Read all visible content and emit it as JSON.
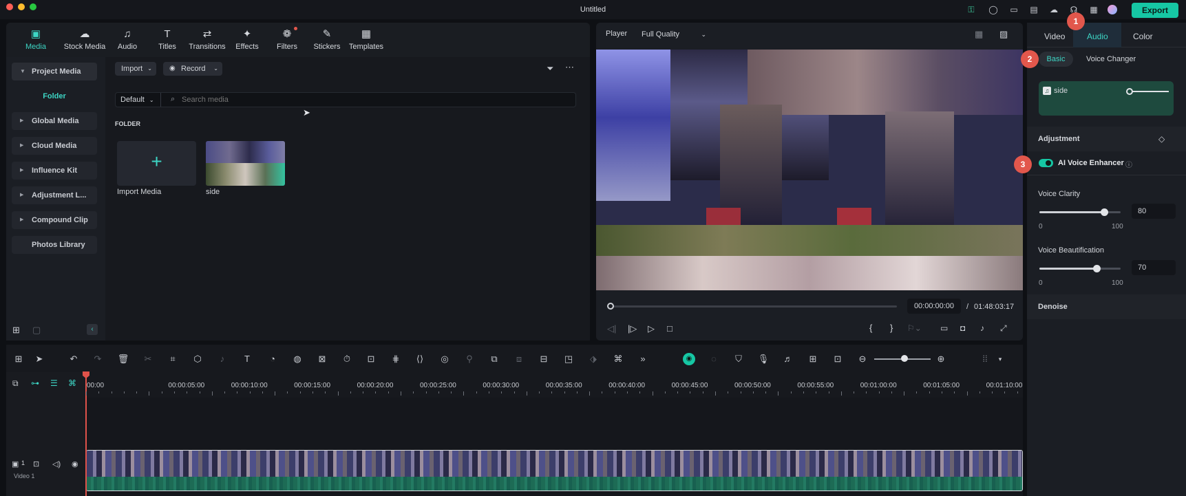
{
  "app": {
    "title": "Untitled",
    "export_label": "Export"
  },
  "toolbar": {
    "tabs": [
      {
        "label": "Media",
        "icon": "media-icon",
        "glyph": "▣"
      },
      {
        "label": "Stock Media",
        "icon": "stock-media-icon",
        "glyph": "☁"
      },
      {
        "label": "Audio",
        "icon": "music-note-icon",
        "glyph": "♫"
      },
      {
        "label": "Titles",
        "icon": "titles-icon",
        "glyph": "T"
      },
      {
        "label": "Transitions",
        "icon": "transitions-icon",
        "glyph": "⇄"
      },
      {
        "label": "Effects",
        "icon": "effects-icon",
        "glyph": "✦"
      },
      {
        "label": "Filters",
        "icon": "filters-icon",
        "glyph": "❁"
      },
      {
        "label": "Stickers",
        "icon": "stickers-icon",
        "glyph": "✎"
      },
      {
        "label": "Templates",
        "icon": "templates-icon",
        "glyph": "▦"
      }
    ]
  },
  "sidebar": {
    "items": [
      {
        "label": "Project Media"
      },
      {
        "label": "Folder"
      },
      {
        "label": "Global Media"
      },
      {
        "label": "Cloud Media"
      },
      {
        "label": "Influence Kit"
      },
      {
        "label": "Adjustment L..."
      },
      {
        "label": "Compound Clip"
      },
      {
        "label": "Photos Library"
      }
    ]
  },
  "media": {
    "import_label": "Import",
    "record_label": "Record",
    "sort_label": "Default",
    "search_placeholder": "Search media",
    "folder_heading": "FOLDER",
    "items": [
      {
        "label": "Import Media"
      },
      {
        "label": "side"
      }
    ]
  },
  "player": {
    "label": "Player",
    "quality": "Full Quality",
    "current_time": "00:00:00:00",
    "separator": "/",
    "total_time": "01:48:03:17",
    "mark_in": "{",
    "mark_out": "}"
  },
  "inspector": {
    "tabs": [
      "Video",
      "Audio",
      "Color"
    ],
    "subtabs": [
      "Basic",
      "Voice Changer"
    ],
    "clip_name": "side",
    "adjustment_label": "Adjustment",
    "ai_voice_label": "AI Voice Enhancer",
    "clarity": {
      "label": "Voice Clarity",
      "value": "80",
      "min": "0",
      "max": "100",
      "fraction": 0.8
    },
    "beautification": {
      "label": "Voice Beautification",
      "value": "70",
      "min": "0",
      "max": "100",
      "fraction": 0.7
    },
    "denoise_label": "Denoise",
    "badges": [
      "1",
      "2",
      "3"
    ]
  },
  "timeline": {
    "ticks": [
      "00:00",
      "00:00:05:00",
      "00:00:10:00",
      "00:00:15:00",
      "00:00:20:00",
      "00:00:25:00",
      "00:00:30:00",
      "00:00:35:00",
      "00:00:40:00",
      "00:00:45:00",
      "00:00:50:00",
      "00:00:55:00",
      "00:01:00:00",
      "00:01:05:00",
      "00:01:10:00"
    ],
    "track_label": "Video 1",
    "track_number": "1"
  },
  "colors": {
    "accent": "#16c7a4",
    "badge": "#e2574c",
    "playhead": "#e0524a"
  }
}
